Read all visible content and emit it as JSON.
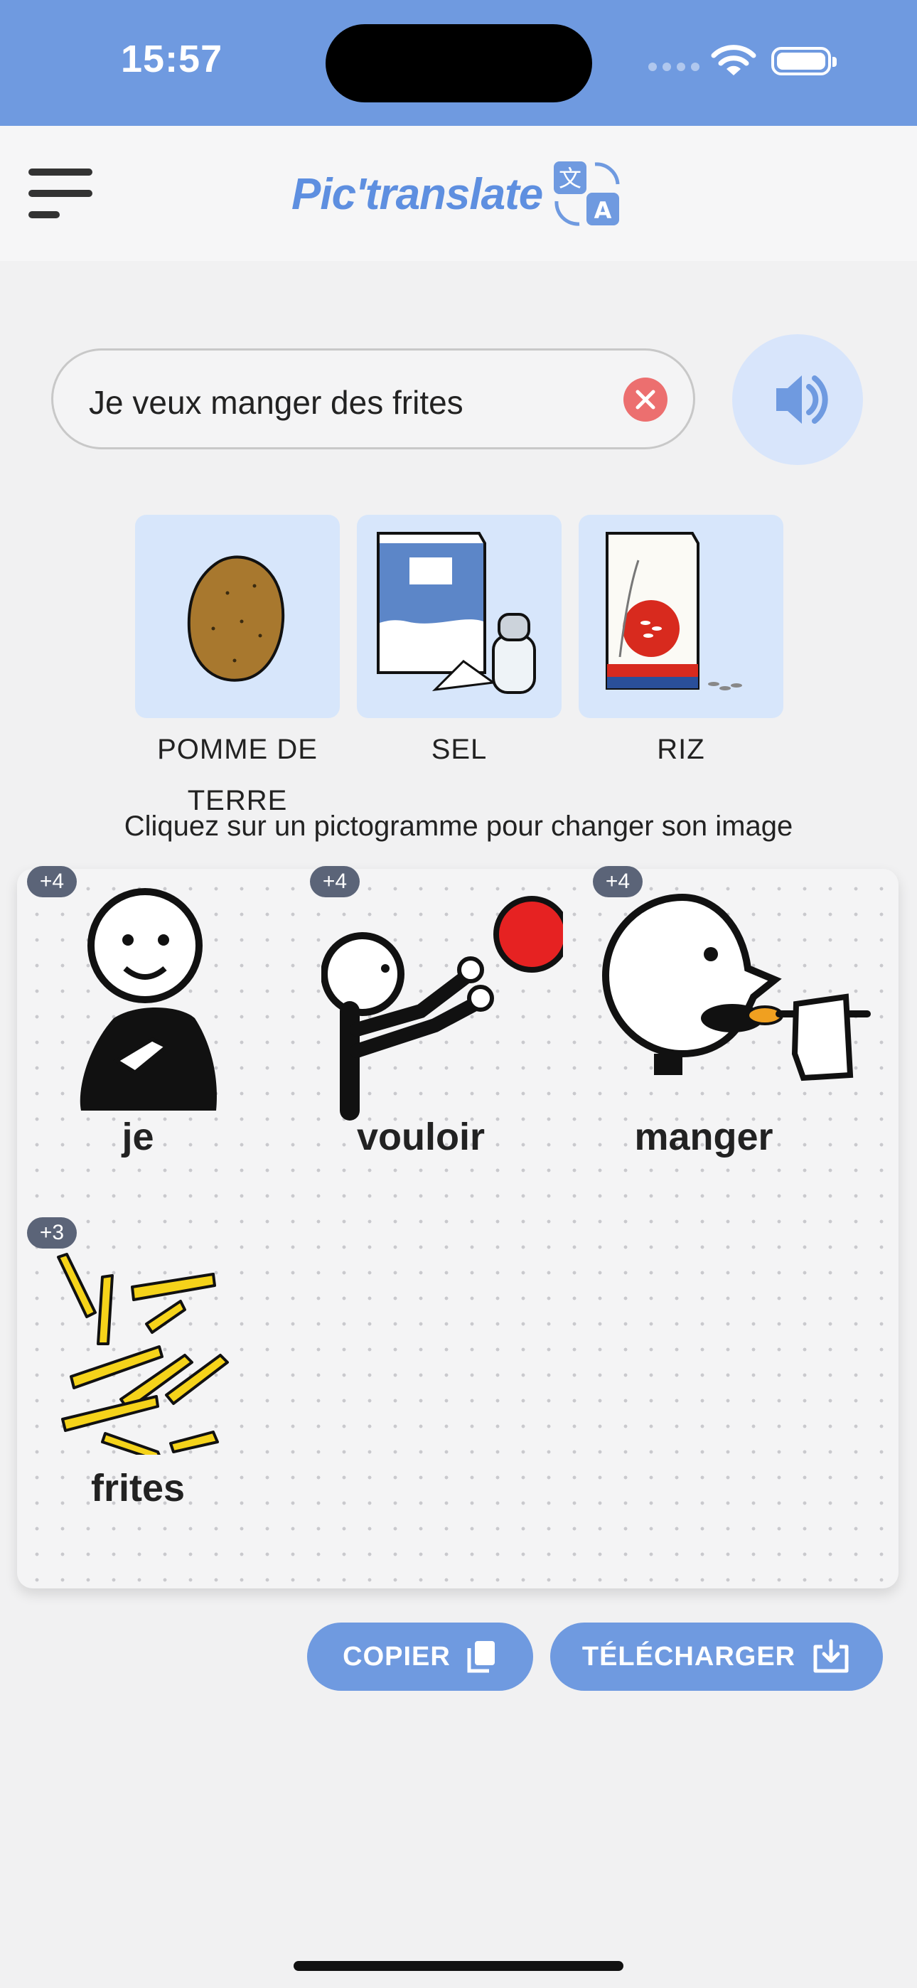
{
  "status_bar": {
    "time": "15:57"
  },
  "header": {
    "app_name": "Pic'translate"
  },
  "search": {
    "value": "Je veux manger des frites"
  },
  "suggestions": [
    {
      "label": "POMME DE TERRE",
      "icon": "potato-picto"
    },
    {
      "label": "SEL",
      "icon": "salt-picto"
    },
    {
      "label": "RIZ",
      "icon": "rice-picto"
    }
  ],
  "hint": "Cliquez sur un pictogramme pour changer son image",
  "board": {
    "cells": [
      {
        "word": "je",
        "badge": "+4",
        "icon": "person-pointing-self-picto"
      },
      {
        "word": "vouloir",
        "badge": "+4",
        "icon": "reach-ball-picto"
      },
      {
        "word": "manger",
        "badge": "+4",
        "icon": "eating-picto"
      },
      {
        "word": "frites",
        "badge": "+3",
        "icon": "fries-picto"
      }
    ]
  },
  "actions": {
    "copy": "COPIER",
    "download": "TÉLÉCHARGER"
  },
  "colors": {
    "primary": "#6f9ae0",
    "clear": "#ec6f6f",
    "card": "#d7e6fb",
    "badge": "#5b6478"
  }
}
